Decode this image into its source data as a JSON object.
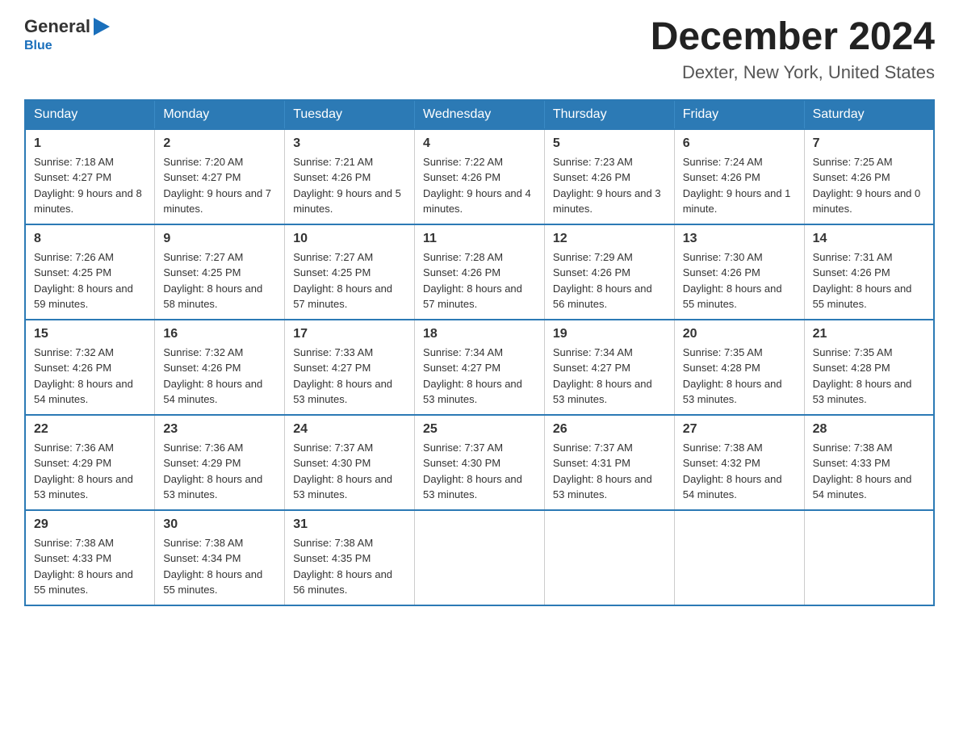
{
  "logo": {
    "general": "General",
    "arrow": "▶",
    "blue": "Blue"
  },
  "title": "December 2024",
  "location": "Dexter, New York, United States",
  "headers": [
    "Sunday",
    "Monday",
    "Tuesday",
    "Wednesday",
    "Thursday",
    "Friday",
    "Saturday"
  ],
  "weeks": [
    [
      {
        "day": "1",
        "sunrise": "7:18 AM",
        "sunset": "4:27 PM",
        "daylight": "9 hours and 8 minutes."
      },
      {
        "day": "2",
        "sunrise": "7:20 AM",
        "sunset": "4:27 PM",
        "daylight": "9 hours and 7 minutes."
      },
      {
        "day": "3",
        "sunrise": "7:21 AM",
        "sunset": "4:26 PM",
        "daylight": "9 hours and 5 minutes."
      },
      {
        "day": "4",
        "sunrise": "7:22 AM",
        "sunset": "4:26 PM",
        "daylight": "9 hours and 4 minutes."
      },
      {
        "day": "5",
        "sunrise": "7:23 AM",
        "sunset": "4:26 PM",
        "daylight": "9 hours and 3 minutes."
      },
      {
        "day": "6",
        "sunrise": "7:24 AM",
        "sunset": "4:26 PM",
        "daylight": "9 hours and 1 minute."
      },
      {
        "day": "7",
        "sunrise": "7:25 AM",
        "sunset": "4:26 PM",
        "daylight": "9 hours and 0 minutes."
      }
    ],
    [
      {
        "day": "8",
        "sunrise": "7:26 AM",
        "sunset": "4:25 PM",
        "daylight": "8 hours and 59 minutes."
      },
      {
        "day": "9",
        "sunrise": "7:27 AM",
        "sunset": "4:25 PM",
        "daylight": "8 hours and 58 minutes."
      },
      {
        "day": "10",
        "sunrise": "7:27 AM",
        "sunset": "4:25 PM",
        "daylight": "8 hours and 57 minutes."
      },
      {
        "day": "11",
        "sunrise": "7:28 AM",
        "sunset": "4:26 PM",
        "daylight": "8 hours and 57 minutes."
      },
      {
        "day": "12",
        "sunrise": "7:29 AM",
        "sunset": "4:26 PM",
        "daylight": "8 hours and 56 minutes."
      },
      {
        "day": "13",
        "sunrise": "7:30 AM",
        "sunset": "4:26 PM",
        "daylight": "8 hours and 55 minutes."
      },
      {
        "day": "14",
        "sunrise": "7:31 AM",
        "sunset": "4:26 PM",
        "daylight": "8 hours and 55 minutes."
      }
    ],
    [
      {
        "day": "15",
        "sunrise": "7:32 AM",
        "sunset": "4:26 PM",
        "daylight": "8 hours and 54 minutes."
      },
      {
        "day": "16",
        "sunrise": "7:32 AM",
        "sunset": "4:26 PM",
        "daylight": "8 hours and 54 minutes."
      },
      {
        "day": "17",
        "sunrise": "7:33 AM",
        "sunset": "4:27 PM",
        "daylight": "8 hours and 53 minutes."
      },
      {
        "day": "18",
        "sunrise": "7:34 AM",
        "sunset": "4:27 PM",
        "daylight": "8 hours and 53 minutes."
      },
      {
        "day": "19",
        "sunrise": "7:34 AM",
        "sunset": "4:27 PM",
        "daylight": "8 hours and 53 minutes."
      },
      {
        "day": "20",
        "sunrise": "7:35 AM",
        "sunset": "4:28 PM",
        "daylight": "8 hours and 53 minutes."
      },
      {
        "day": "21",
        "sunrise": "7:35 AM",
        "sunset": "4:28 PM",
        "daylight": "8 hours and 53 minutes."
      }
    ],
    [
      {
        "day": "22",
        "sunrise": "7:36 AM",
        "sunset": "4:29 PM",
        "daylight": "8 hours and 53 minutes."
      },
      {
        "day": "23",
        "sunrise": "7:36 AM",
        "sunset": "4:29 PM",
        "daylight": "8 hours and 53 minutes."
      },
      {
        "day": "24",
        "sunrise": "7:37 AM",
        "sunset": "4:30 PM",
        "daylight": "8 hours and 53 minutes."
      },
      {
        "day": "25",
        "sunrise": "7:37 AM",
        "sunset": "4:30 PM",
        "daylight": "8 hours and 53 minutes."
      },
      {
        "day": "26",
        "sunrise": "7:37 AM",
        "sunset": "4:31 PM",
        "daylight": "8 hours and 53 minutes."
      },
      {
        "day": "27",
        "sunrise": "7:38 AM",
        "sunset": "4:32 PM",
        "daylight": "8 hours and 54 minutes."
      },
      {
        "day": "28",
        "sunrise": "7:38 AM",
        "sunset": "4:33 PM",
        "daylight": "8 hours and 54 minutes."
      }
    ],
    [
      {
        "day": "29",
        "sunrise": "7:38 AM",
        "sunset": "4:33 PM",
        "daylight": "8 hours and 55 minutes."
      },
      {
        "day": "30",
        "sunrise": "7:38 AM",
        "sunset": "4:34 PM",
        "daylight": "8 hours and 55 minutes."
      },
      {
        "day": "31",
        "sunrise": "7:38 AM",
        "sunset": "4:35 PM",
        "daylight": "8 hours and 56 minutes."
      },
      null,
      null,
      null,
      null
    ]
  ],
  "labels": {
    "sunrise_prefix": "Sunrise: ",
    "sunset_prefix": "Sunset: ",
    "daylight_prefix": "Daylight: "
  }
}
